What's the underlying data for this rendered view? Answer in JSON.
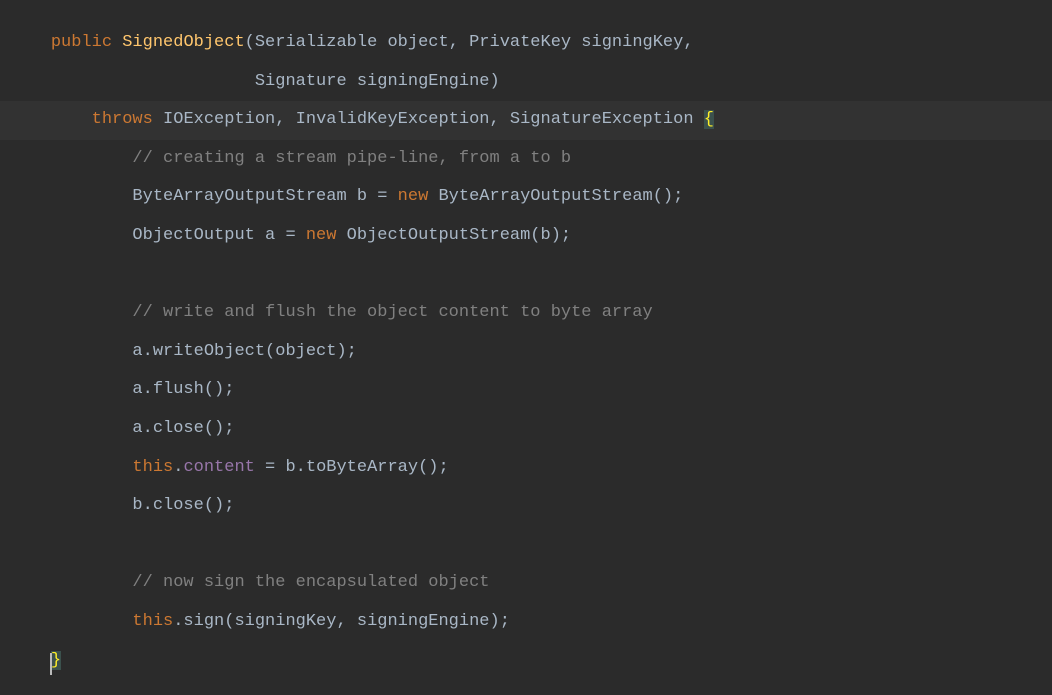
{
  "colors": {
    "background": "#2b2b2b",
    "highlight": "#323232",
    "keyword": "#cc7832",
    "method": "#ffc66d",
    "field": "#9876aa",
    "comment": "#808080",
    "default": "#a9b7c6",
    "braceMatch": "#ffef28",
    "braceMatchBg": "#3b514d"
  },
  "gutter": {
    "m1": "",
    "m2": ""
  },
  "code": {
    "l0": {
      "kw_public": "public",
      "method_name": "SignedObject",
      "params": "(Serializable object, PrivateKey signingKey,"
    },
    "l1": {
      "params2": "Signature signingEngine)"
    },
    "l2": {
      "kw_throws": "throws",
      "exceptions": " IOException, InvalidKeyException, SignatureException ",
      "brace": "{"
    },
    "l3": {
      "comment": "// creating a stream pipe-line, from a to b"
    },
    "l4": {
      "part1": "ByteArrayOutputStream b = ",
      "kw_new": "new",
      "part2": " ByteArrayOutputStream();"
    },
    "l5": {
      "part1": "ObjectOutput a = ",
      "kw_new": "new",
      "part2": " ObjectOutputStream(b);"
    },
    "l6": {
      "empty": ""
    },
    "l7": {
      "comment": "// write and flush the object content to byte array"
    },
    "l8": {
      "stmt": "a.writeObject(object);"
    },
    "l9": {
      "stmt": "a.flush();"
    },
    "l10": {
      "stmt": "a.close();"
    },
    "l11": {
      "kw_this": "this",
      "dot": ".",
      "field": "content",
      "rest": " = b.toByteArray();"
    },
    "l12": {
      "stmt": "b.close();"
    },
    "l13": {
      "empty": ""
    },
    "l14": {
      "comment": "// now sign the encapsulated object"
    },
    "l15": {
      "kw_this": "this",
      "rest": ".sign(signingKey, signingEngine);"
    },
    "l16": {
      "brace": "}"
    }
  }
}
